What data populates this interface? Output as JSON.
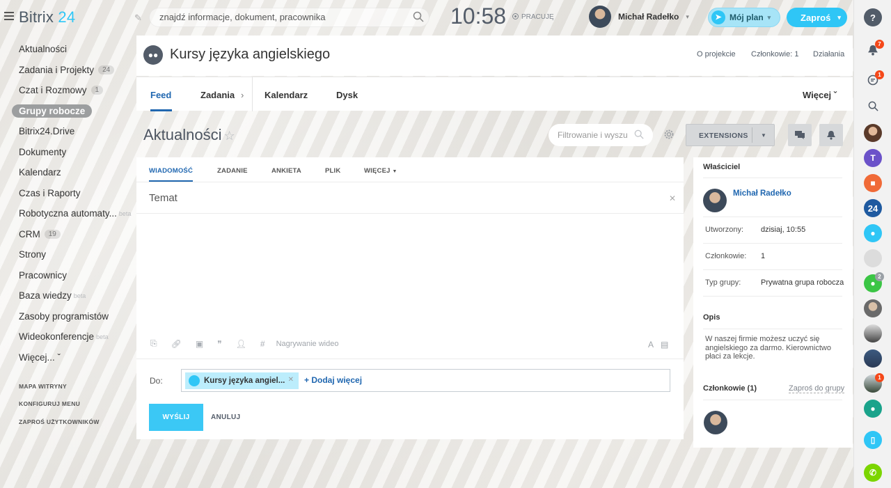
{
  "brand": {
    "name": "Bitrix",
    "num": "24"
  },
  "header": {
    "search_placeholder": "znajdź informacje, dokument, pracownika",
    "clock": "10:58",
    "status": "PRACUJĘ",
    "user_name": "Michał Radełko",
    "plan_label": "Mój plan",
    "invite_label": "Zaproś"
  },
  "menu": {
    "items": [
      {
        "label": "Aktualności"
      },
      {
        "label": "Zadania i Projekty",
        "badge": "24"
      },
      {
        "label": "Czat i Rozmowy",
        "badge": "1"
      },
      {
        "label": "Grupy robocze",
        "active": true
      },
      {
        "label": "Bitrix24.Drive"
      },
      {
        "label": "Dokumenty"
      },
      {
        "label": "Kalendarz"
      },
      {
        "label": "Czas i Raporty"
      },
      {
        "label": "Robotyczna automaty...",
        "sup": "beta"
      },
      {
        "label": "CRM",
        "badge": "19"
      },
      {
        "label": "Strony"
      },
      {
        "label": "Pracownicy"
      },
      {
        "label": "Baza wiedzy",
        "sup": "beta"
      },
      {
        "label": "Zasoby programistów"
      },
      {
        "label": "Wideokonferencje",
        "sup": "beta"
      },
      {
        "label": "Więcej... ˇ"
      }
    ],
    "sub": [
      "MAPA WITRYNY",
      "KONFIGURUJ MENU",
      "ZAPROŚ UŻYTKOWNIKÓW"
    ]
  },
  "group": {
    "title": "Kursy języka angielskiego",
    "links": {
      "about": "O projekcie",
      "members": "Członkowie: 1",
      "actions": "Działania"
    },
    "tabs": {
      "feed": "Feed",
      "tasks": "Zadania",
      "calendar": "Kalendarz",
      "disk": "Dysk",
      "more": "Więcej ˇ"
    }
  },
  "page": {
    "title": "Aktualności",
    "filter_placeholder": "Filtrowanie i wyszu",
    "extensions": "EXTENSIONS"
  },
  "form": {
    "tabs": [
      "WIADOMOŚĆ",
      "ZADANIE",
      "ANKIETA",
      "PLIK",
      "WIĘCEJ"
    ],
    "topic": "Temat",
    "record_video": "Nagrywanie wideo",
    "to_label": "Do:",
    "chip": "Kursy języka angiel...",
    "add_more": "+ Dodaj więcej",
    "send": "WYŚLIJ",
    "cancel": "ANULUJ"
  },
  "side": {
    "owner_h": "Właściciel",
    "owner_name": "Michał Radełko",
    "created_k": "Utworzony:",
    "created_v": "dzisiaj, 10:55",
    "members_k": "Członkowie:",
    "members_v": "1",
    "type_k": "Typ grupy:",
    "type_v": "Prywatna grupa robocza",
    "desc_h": "Opis",
    "desc": "W naszej firmie możesz uczyć się angielskiego za darmo. Kierownictwo płaci za lekcje.",
    "members_h": "Członkowie (1)",
    "invite_group": "Zaproś do grupy"
  },
  "rail": {
    "notifications_badge": "7",
    "chat_badge": "1",
    "t_letter": "T",
    "b24": "24",
    "user2_badge": "2",
    "user3_badge": "1"
  },
  "colors": {
    "accent": "#2fc6f6",
    "link": "#2067b0",
    "badge": "#f54819"
  }
}
